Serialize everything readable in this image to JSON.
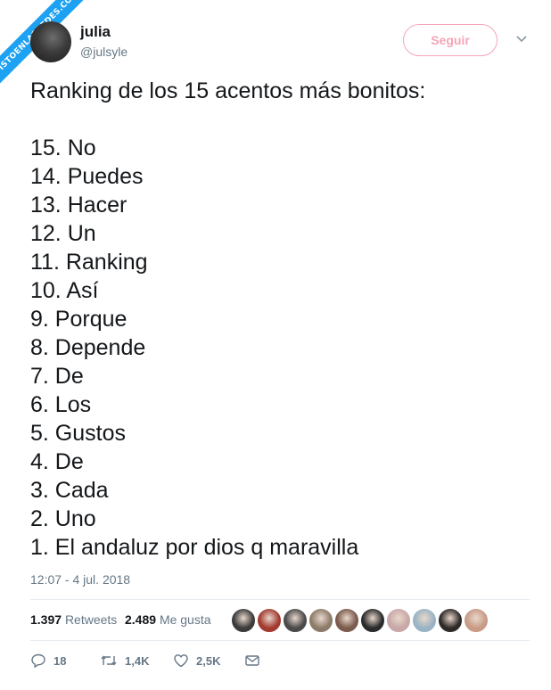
{
  "watermark": "VISTOENLASREDES.COM",
  "user": {
    "name": "julia",
    "handle": "@julsyle"
  },
  "follow_label": "Seguir",
  "tweet": {
    "intro": "Ranking de los 15 acentos más bonitos:",
    "items": [
      "15. No",
      "14. Puedes",
      "13. Hacer",
      "12. Un",
      "11. Ranking",
      "10. Así",
      "9. Porque",
      "8. Depende",
      "7. De",
      "6. Los",
      "5. Gustos",
      "4. De",
      "3. Cada",
      "2. Uno",
      "1. El andaluz por dios q maravilla"
    ],
    "timestamp": "12:07 - 4 jul. 2018"
  },
  "stats": {
    "retweets_count": "1.397",
    "retweets_label": "Retweets",
    "likes_count": "2.489",
    "likes_label": "Me gusta"
  },
  "likers": [
    "#3b3b3b",
    "#a33a2f",
    "#4a4a4a",
    "#8d7b6a",
    "#7a5b4c",
    "#2b2b2b",
    "#c9a7a7",
    "#9ab3c4",
    "#2e2a28",
    "#c89b86"
  ],
  "actions": {
    "replies": "18",
    "retweets": "1,4K",
    "likes": "2,5K"
  },
  "colors": {
    "accent": "#1da1f2",
    "follow": "#f5a5b8",
    "muted": "#657786"
  }
}
